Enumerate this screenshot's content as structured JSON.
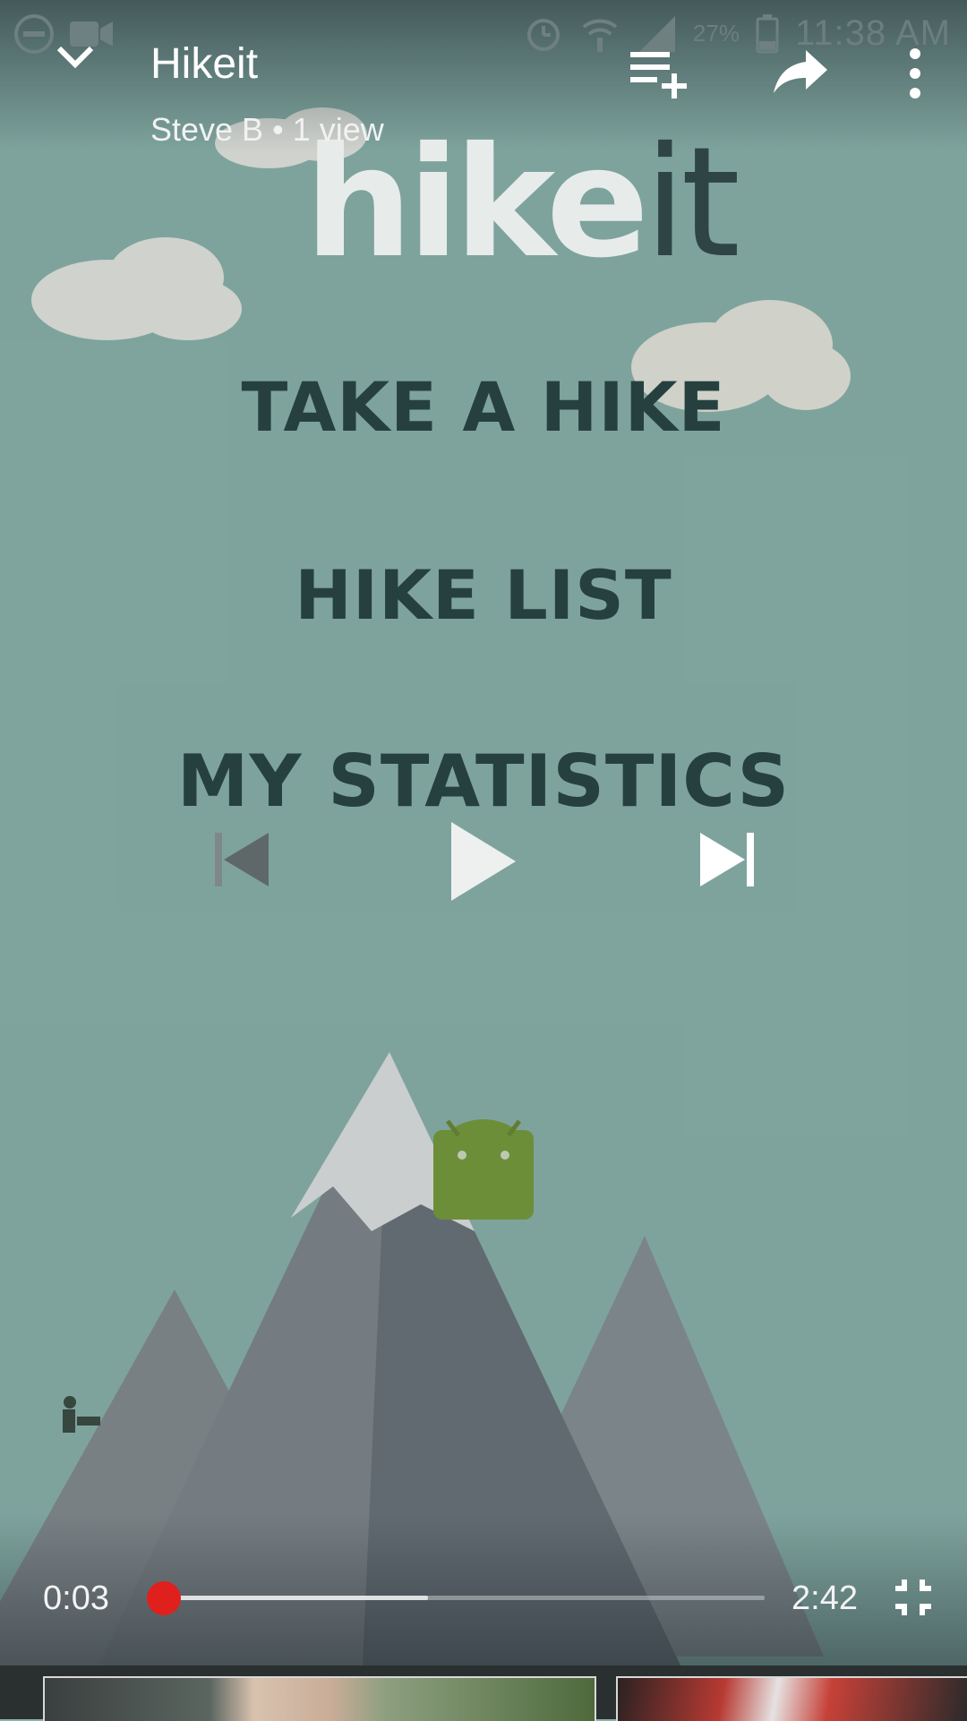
{
  "status_bar": {
    "battery": "27%",
    "time": "11:38 AM",
    "icons": [
      "do-not-disturb-icon",
      "video-record-icon",
      "alarm-icon",
      "wifi-icon",
      "signal-icon",
      "battery-icon"
    ]
  },
  "player": {
    "title": "Hikeit",
    "meta": "Steve B • 1 view",
    "current_time": "0:03",
    "total_time": "2:42",
    "progress_fraction": 0.0185,
    "buffered_fraction": 0.45,
    "colors": {
      "progress": "#e52d27",
      "background": "#92bbb4"
    }
  },
  "video_frame": {
    "logo_main": "hike",
    "logo_suffix": "it",
    "menu": [
      "TAKE A HIKE",
      "HIKE LIST",
      "MY STATISTICS"
    ]
  },
  "controls": {
    "icons": [
      "chevron-down-icon",
      "add-to-queue-icon",
      "share-icon",
      "more-vert-icon",
      "skip-previous-icon",
      "play-icon",
      "skip-next-icon",
      "exit-fullscreen-icon"
    ]
  }
}
